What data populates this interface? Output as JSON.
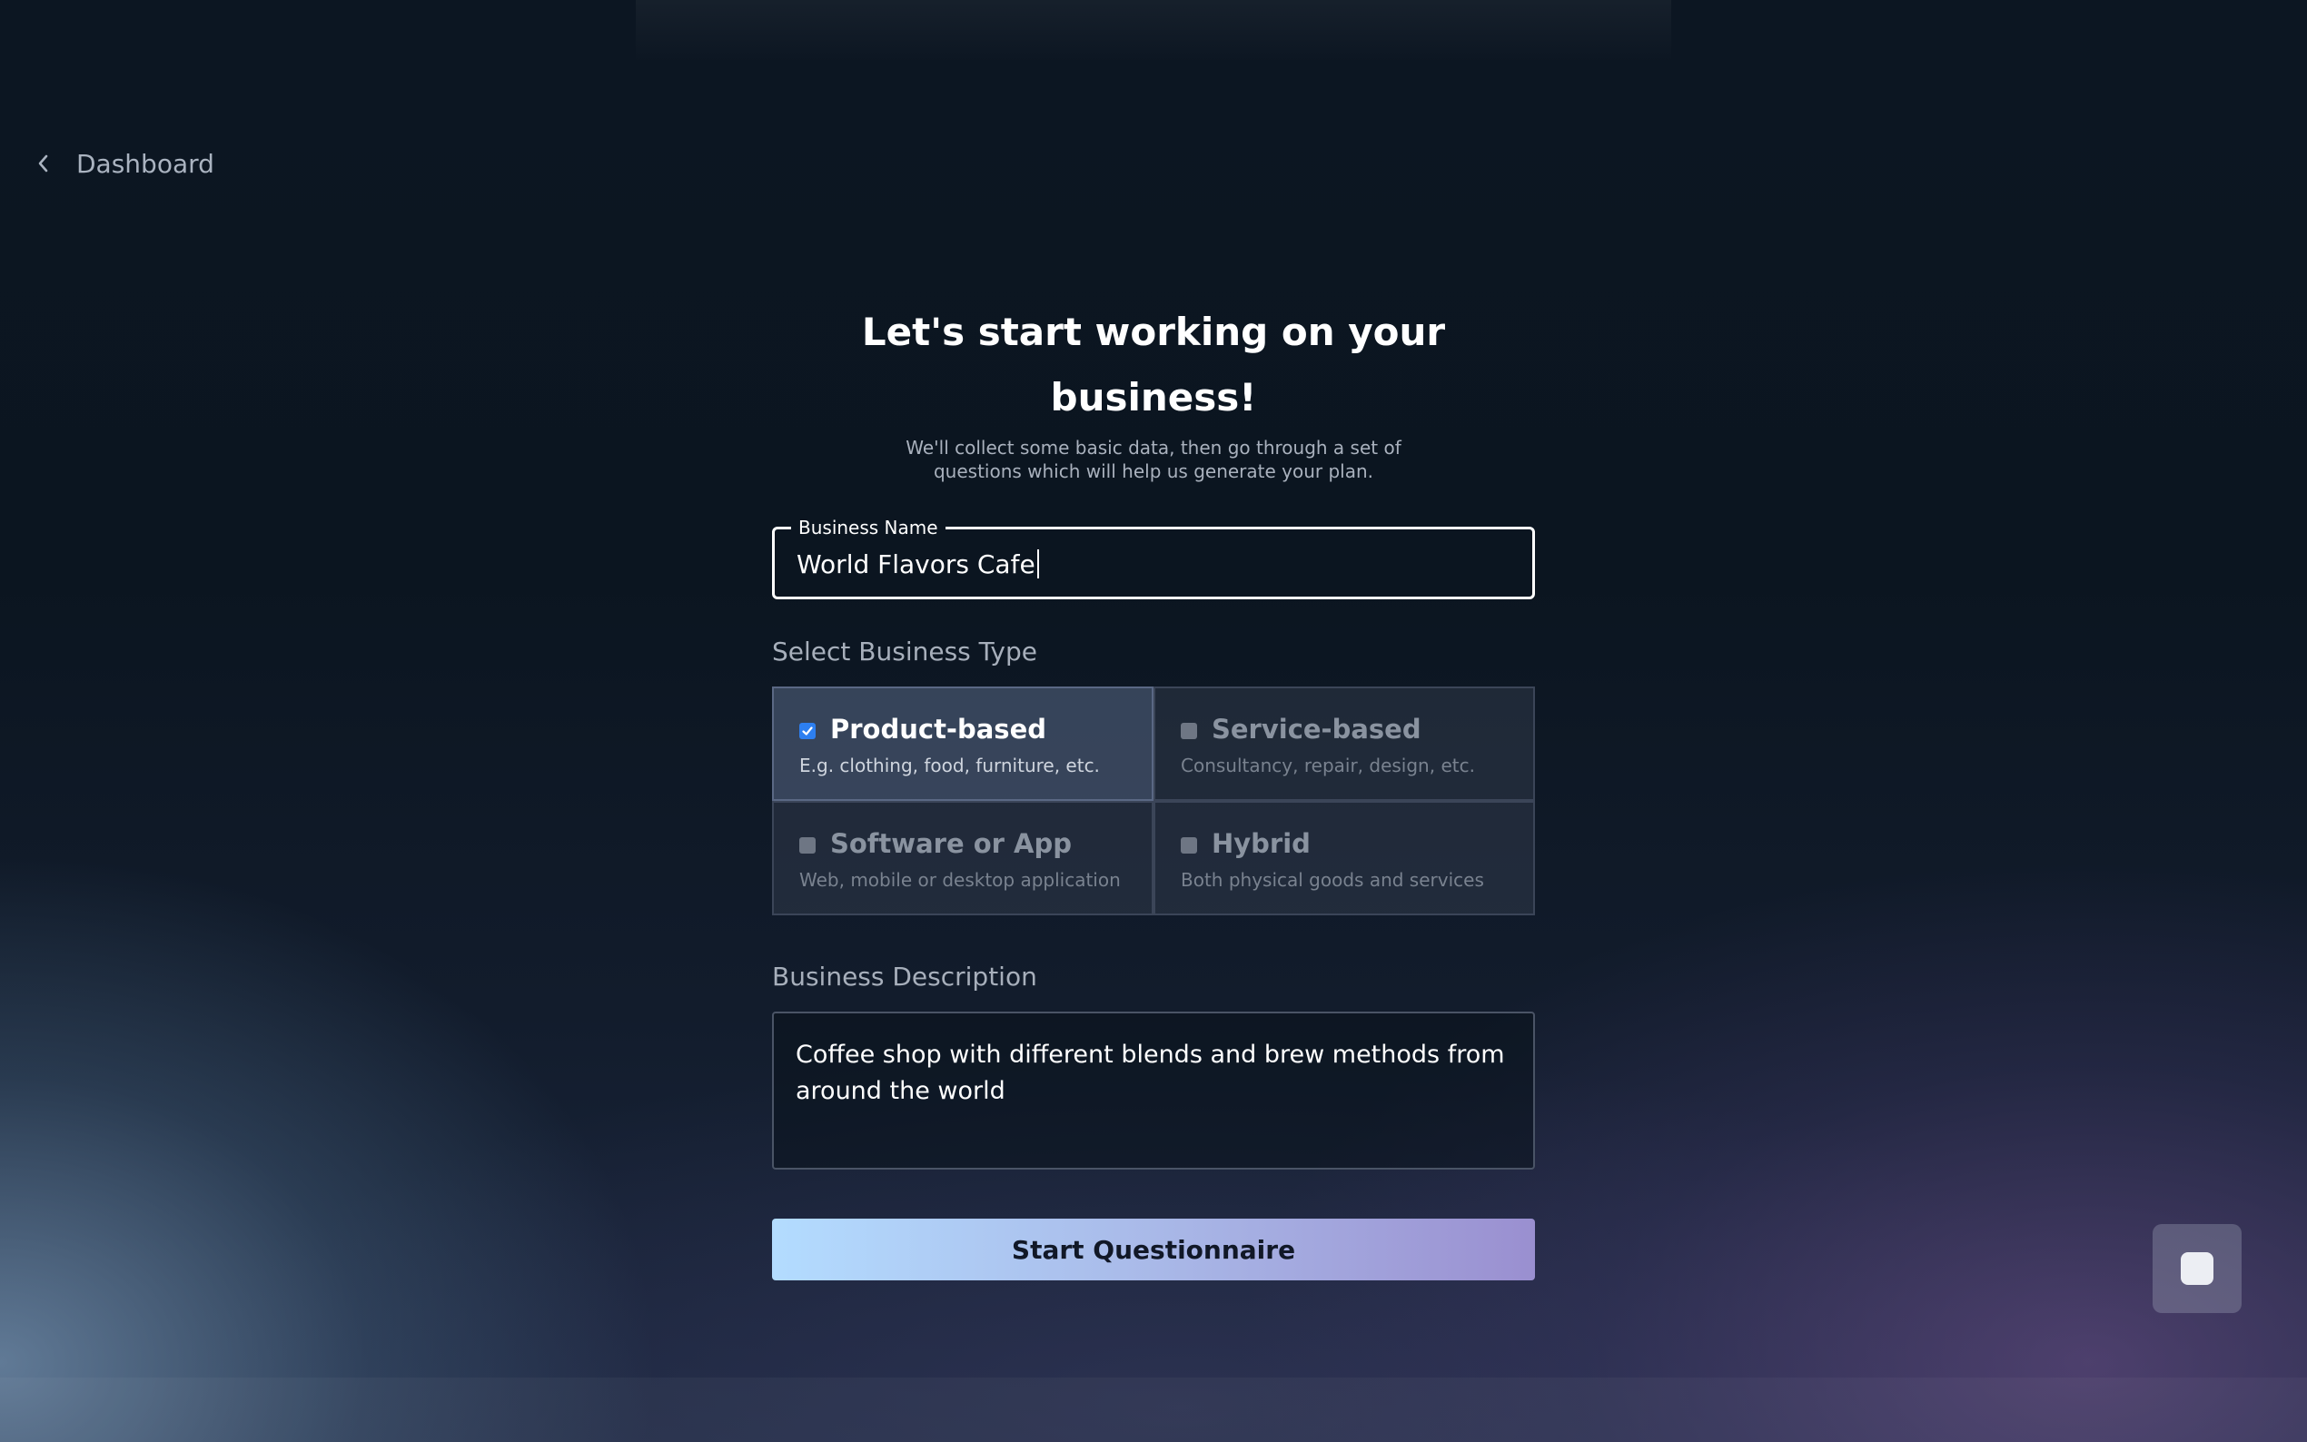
{
  "nav": {
    "back_label": "Dashboard",
    "back_icon": "chevron-left-icon"
  },
  "header": {
    "title": "Let's start working on your business!",
    "subtitle": "We'll collect some basic data, then go through a set of questions which will help us generate your plan."
  },
  "business_name": {
    "label": "Business Name",
    "value": "World Flavors Cafe"
  },
  "business_type": {
    "label": "Select Business Type",
    "options": [
      {
        "name": "Product-based",
        "description": "E.g. clothing, food, furniture, etc.",
        "checked": true
      },
      {
        "name": "Service-based",
        "description": "Consultancy, repair, design, etc.",
        "checked": false
      },
      {
        "name": "Software or App",
        "description": "Web, mobile or desktop application",
        "checked": false
      },
      {
        "name": "Hybrid",
        "description": "Both physical goods and services",
        "checked": false
      }
    ]
  },
  "business_description": {
    "label": "Business Description",
    "value": "Coffee shop with different blends and brew methods from around the world"
  },
  "actions": {
    "start_label": "Start Questionnaire"
  },
  "colors": {
    "accent_checkbox": "#2d7ff0",
    "button_gradient_start": "#b3dcff",
    "button_gradient_end": "#9a8fd0",
    "background": "#0b1520"
  }
}
